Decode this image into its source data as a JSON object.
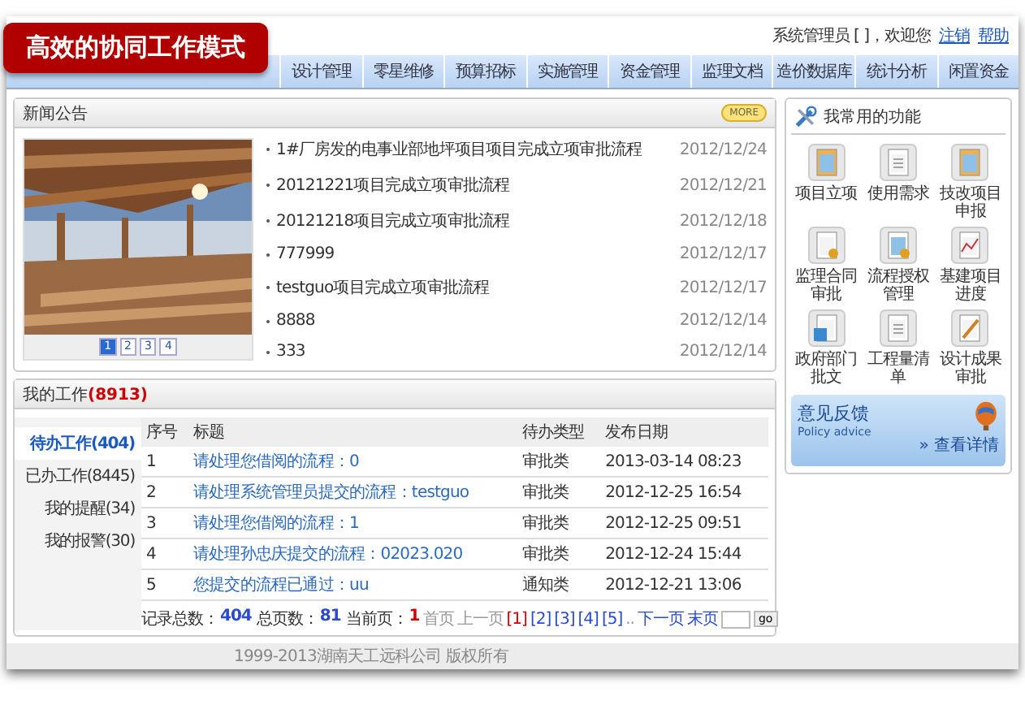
{
  "banner": {
    "title": "高效的协同工作模式"
  },
  "header": {
    "user": "系统管理员 [ ]，欢迎您",
    "links": [
      "注销",
      "帮助"
    ]
  },
  "nav": [
    "设计管理",
    "零星维修",
    "预算招标",
    "实施管理",
    "资金管理",
    "监理文档",
    "造价数据库",
    "统计分析",
    "闲置资金"
  ],
  "news": {
    "title": "新闻公告",
    "more": "MORE",
    "slides": [
      {
        "label": "1",
        "selected": true
      },
      {
        "label": "2",
        "selected": false
      },
      {
        "label": "3",
        "selected": false
      },
      {
        "label": "4",
        "selected": false
      }
    ],
    "items": [
      {
        "title": "1#厂房发的电事业部地坪项目项目完成立项审批流程",
        "date": "2012/12/24"
      },
      {
        "title": "20121221项目完成立项审批流程",
        "date": "2012/12/21"
      },
      {
        "title": "20121218项目完成立项审批流程",
        "date": "2012/12/18"
      },
      {
        "title": "777999",
        "date": "2012/12/17"
      },
      {
        "title": "testguo项目完成立项审批流程",
        "date": "2012/12/17"
      },
      {
        "title": "8888",
        "date": "2012/12/14"
      },
      {
        "title": "333",
        "date": "2012/12/14"
      }
    ]
  },
  "functions": {
    "title": "我常用的功能",
    "items": [
      "项目立项",
      "使用需求",
      "技改项目申报",
      "监理合同审批",
      "流程授权管理",
      "基建项目进度",
      "政府部门批文",
      "工程量清单",
      "设计成果审批"
    ]
  },
  "feedback": {
    "title": "意见反馈",
    "subtitle": "Policy advice",
    "link": "» 查看详情"
  },
  "work": {
    "title": "我的工作",
    "count": "(8913)",
    "tabs": [
      {
        "label": "待办工作(404)",
        "selected": true
      },
      {
        "label": "已办工作(8445)",
        "selected": false
      },
      {
        "label": "我的提醒(34)",
        "selected": false
      },
      {
        "label": "我的报警(30)",
        "selected": false
      }
    ],
    "columns": [
      "序号",
      "标题",
      "待办类型",
      "发布日期"
    ],
    "rows": [
      {
        "no": "1",
        "title": "请处理您借阅的流程：0",
        "type": "审批类",
        "date": "2013-03-14 08:23"
      },
      {
        "no": "2",
        "title": "请处理系统管理员提交的流程：testguo",
        "type": "审批类",
        "date": "2012-12-25 16:54"
      },
      {
        "no": "3",
        "title": "请处理您借阅的流程：1",
        "type": "审批类",
        "date": "2012-12-25 09:51"
      },
      {
        "no": "4",
        "title": "请处理孙忠庆提交的流程：02023.020",
        "type": "审批类",
        "date": "2012-12-24 15:44"
      },
      {
        "no": "5",
        "title": "您提交的流程已通过：uu",
        "type": "通知类",
        "date": "2012-12-21 13:06"
      }
    ],
    "summary": [
      {
        "label": "记录总数：",
        "value": "404",
        "kind": "count"
      },
      {
        "label": "总页数：",
        "value": "81",
        "kind": "count"
      },
      {
        "label": "当前页：",
        "value": "1",
        "kind": "current"
      }
    ],
    "pager": {
      "first": "首页",
      "prev": "上一页",
      "pages": [
        {
          "label": "[1]",
          "selected": true
        },
        {
          "label": "[2]",
          "selected": false
        },
        {
          "label": "[3]",
          "selected": false
        },
        {
          "label": "[4]",
          "selected": false
        },
        {
          "label": "[5]",
          "selected": false
        }
      ],
      "ellipsis": "..",
      "next": "下一页",
      "last": "末页",
      "go": "go"
    }
  },
  "footer": "1999-2013湖南天工远科公司 版权所有"
}
